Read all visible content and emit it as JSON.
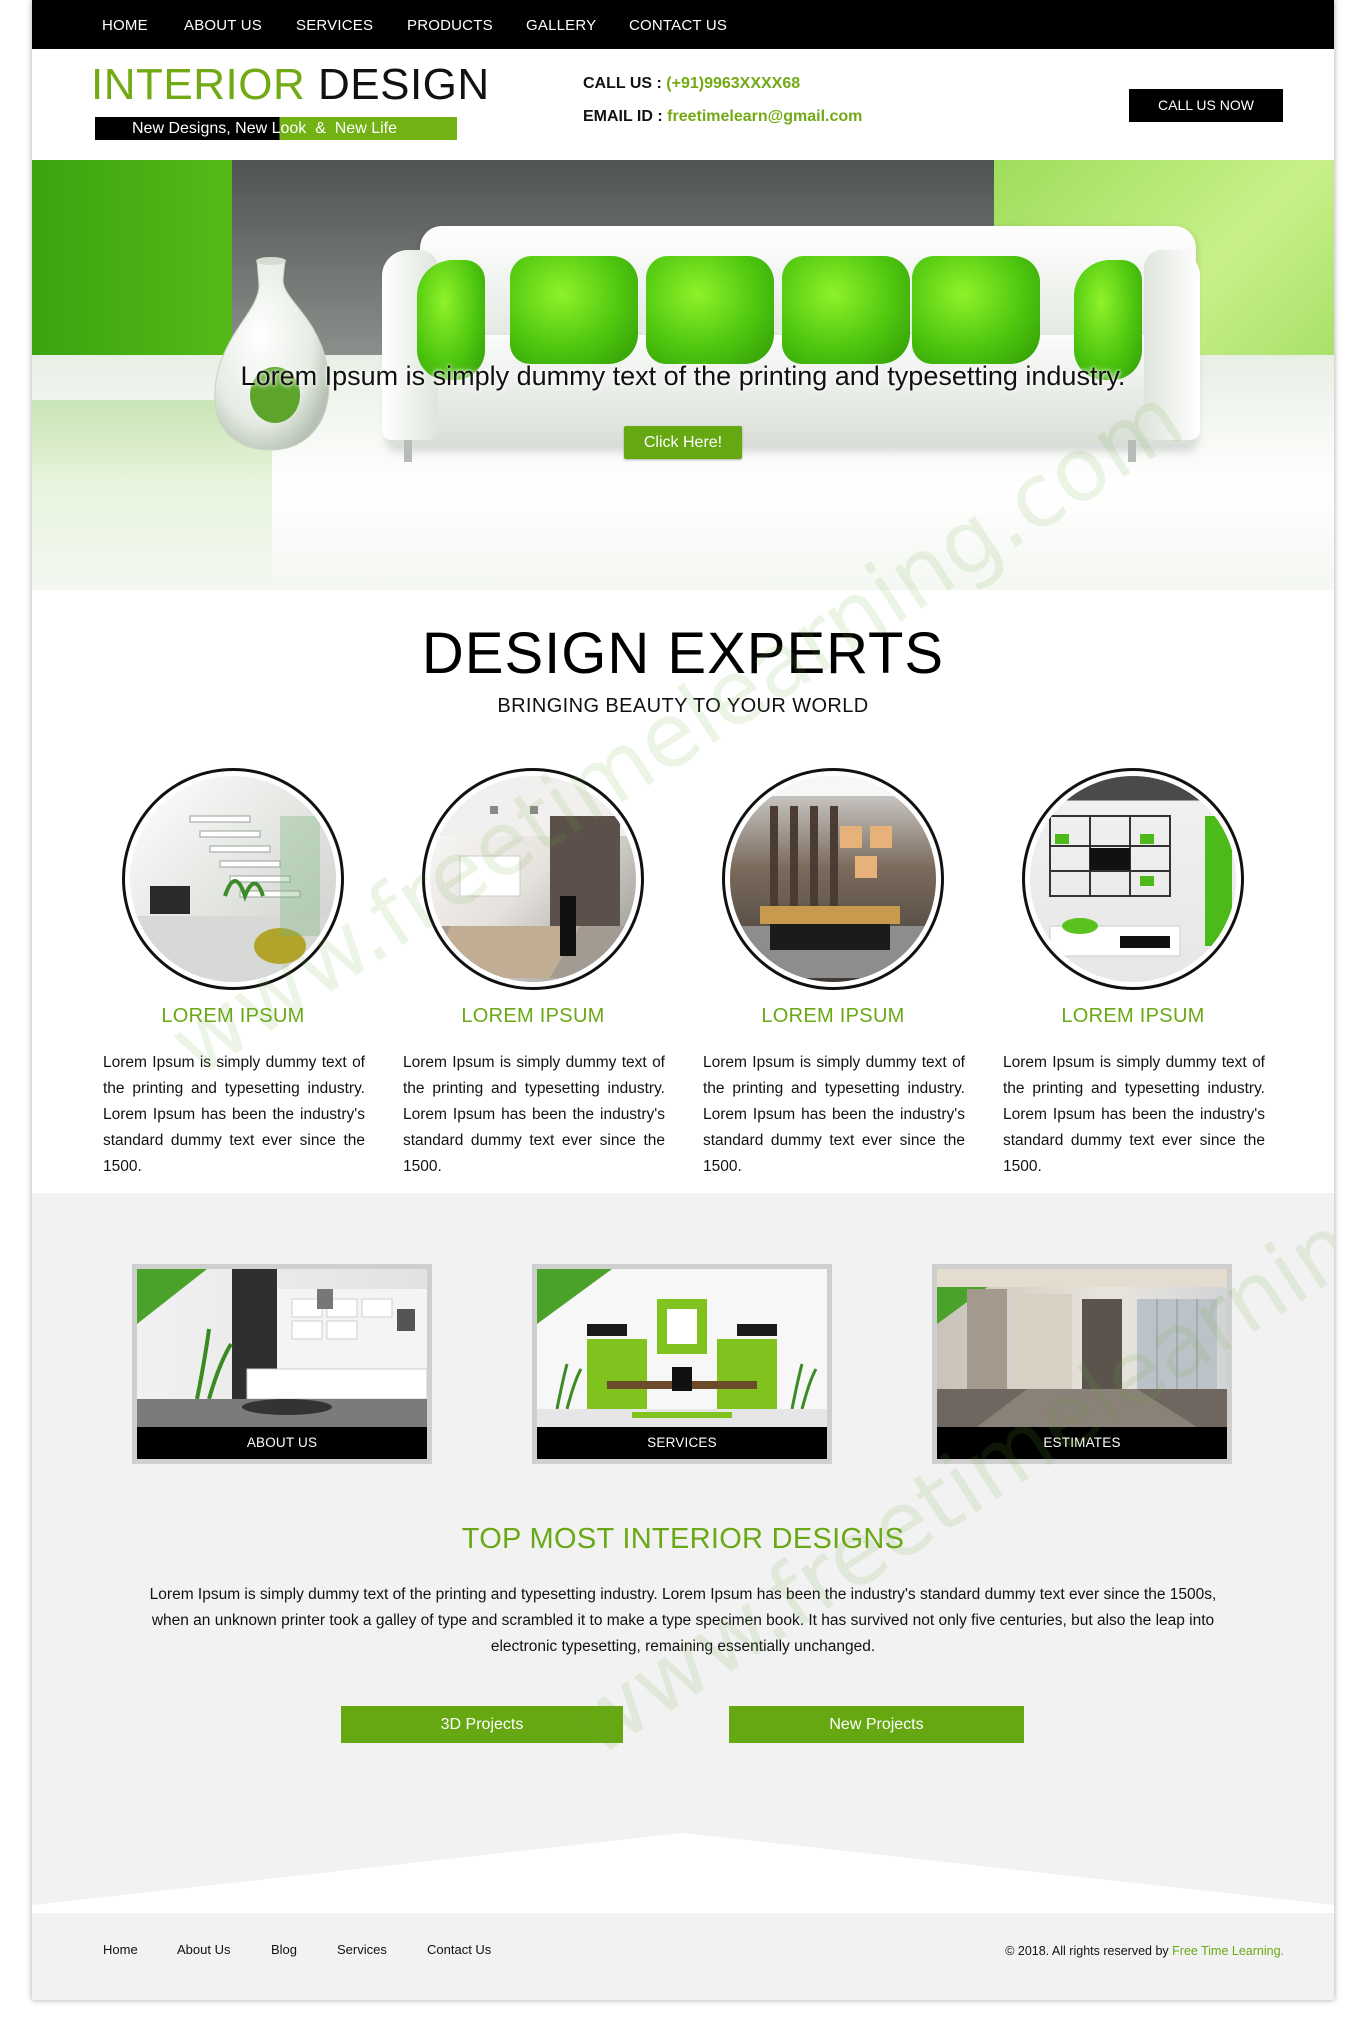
{
  "nav": {
    "items": [
      "HOME",
      "ABOUT US",
      "SERVICES",
      "PRODUCTS",
      "GALLERY",
      "CONTACT US"
    ]
  },
  "header": {
    "logo_part1": "INTERIOR",
    "logo_part2": "DESIGN",
    "tagline": "New Designs, New Look  &  New Life",
    "call_label": "CALL US :",
    "call_value": "(+91)9963XXXX68",
    "email_label": "EMAIL ID :",
    "email_value": "freetimelearn@gmail.com",
    "call_now": "CALL US NOW"
  },
  "hero": {
    "text": "Lorem Ipsum is simply dummy text of the printing and typesetting industry.",
    "button": "Click Here!"
  },
  "experts": {
    "title": "DESIGN EXPERTS",
    "subtitle": "BRINGING BEAUTY TO YOUR WORLD",
    "columns": [
      {
        "heading": "LOREM IPSUM",
        "text": "Lorem Ipsum is simply dummy text of the printing and typesetting industry. Lorem Ipsum has been the industry's standard dummy text ever since the 1500."
      },
      {
        "heading": "LOREM IPSUM",
        "text": "Lorem Ipsum is simply dummy text of the printing and typesetting industry. Lorem Ipsum has been the industry's standard dummy text ever since the 1500."
      },
      {
        "heading": "LOREM IPSUM",
        "text": "Lorem Ipsum is simply dummy text of the printing and typesetting industry. Lorem Ipsum has been the industry's standard dummy text ever since the 1500."
      },
      {
        "heading": "LOREM IPSUM",
        "text": "Lorem Ipsum is simply dummy text of the printing and typesetting industry. Lorem Ipsum has been the industry's standard dummy text ever since the 1500."
      }
    ]
  },
  "cards": [
    "ABOUT US",
    "SERVICES",
    "ESTIMATES"
  ],
  "top_designs": {
    "title": "TOP MOST INTERIOR DESIGNS",
    "text": "Lorem Ipsum is simply dummy text of the printing and typesetting industry. Lorem Ipsum has been the industry's standard dummy text ever since the 1500s, when an unknown printer took a galley of type and scrambled it to make a type specimen book. It has survived not only five centuries, but also the leap into electronic typesetting, remaining essentially unchanged.",
    "btn_3d": "3D Projects",
    "btn_new": "New Projects"
  },
  "footer": {
    "links": [
      "Home",
      "About Us",
      "Blog",
      "Services",
      "Contact Us"
    ],
    "copyright": "© 2018. All rights reserved by",
    "brand": "Free Time Learning."
  },
  "watermark": "www.freetimelearning.com",
  "colors": {
    "accent_green": "#72aa15",
    "button_green": "#66a812",
    "nav_black": "#000000",
    "band_grey": "#f2f2f2"
  }
}
